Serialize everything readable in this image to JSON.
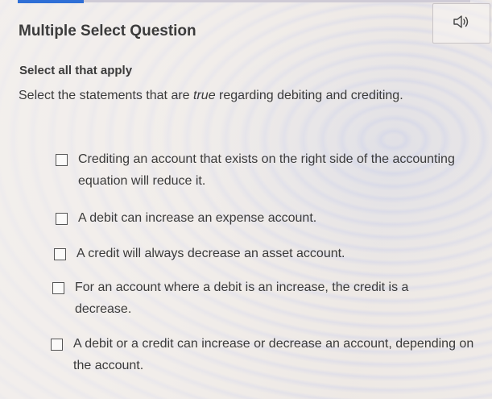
{
  "question": {
    "title": "Multiple Select Question",
    "instruction": "Select all that apply",
    "prompt_before": "Select the statements that are ",
    "prompt_emphasis": "true",
    "prompt_after": " regarding debiting and crediting."
  },
  "audio": {
    "icon": "speaker-icon"
  },
  "options": [
    {
      "label": "Crediting an account that exists on the right side of the accounting equation will reduce it.",
      "checked": false
    },
    {
      "label": "A debit can increase an expense account.",
      "checked": false
    },
    {
      "label": "A credit will always decrease an asset account.",
      "checked": false
    },
    {
      "label": "For an account where a debit is an increase, the credit is a decrease.",
      "checked": false
    },
    {
      "label": "A debit or a credit can increase or decrease an account, depending on the account.",
      "checked": false
    }
  ],
  "colors": {
    "accent": "#2f6fd6",
    "text": "#3b3b3b"
  }
}
